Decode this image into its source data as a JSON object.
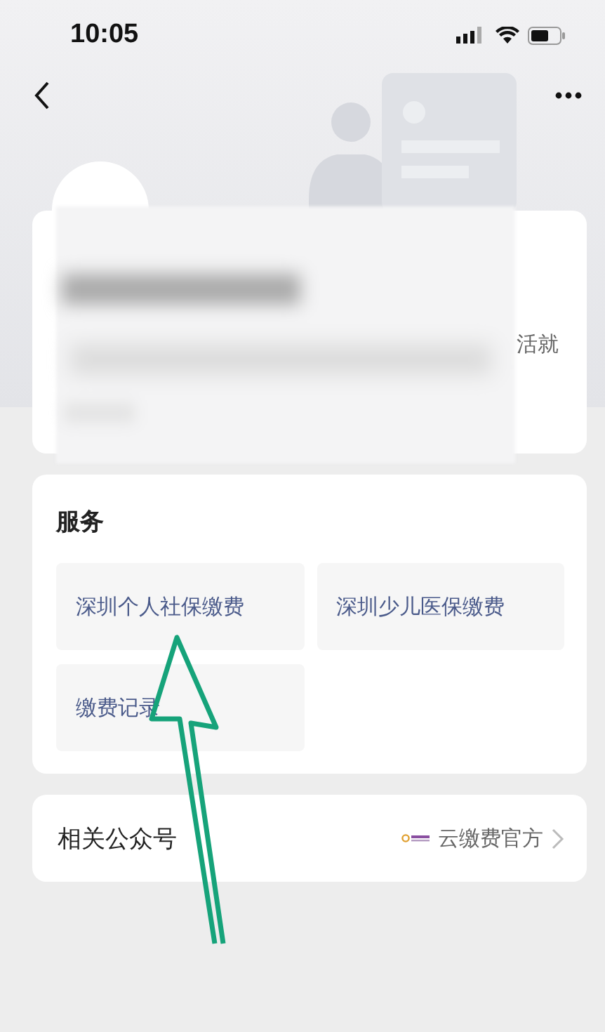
{
  "status_bar": {
    "time": "10:05"
  },
  "profile": {
    "description_tail": "活就"
  },
  "services": {
    "title": "服务",
    "items": [
      {
        "label": "深圳个人社保缴费"
      },
      {
        "label": "深圳少儿医保缴费"
      },
      {
        "label": "缴费记录"
      }
    ]
  },
  "related": {
    "label": "相关公众号",
    "account": "云缴费官方"
  }
}
